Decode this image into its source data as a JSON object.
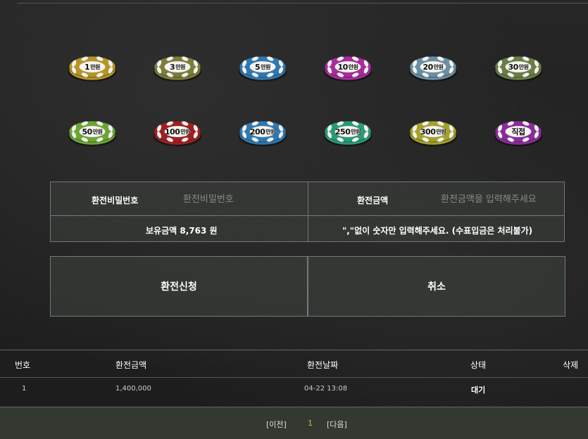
{
  "chips": [
    {
      "label": "1",
      "unit": "만원",
      "color": "#b59526"
    },
    {
      "label": "3",
      "unit": "만원",
      "color": "#7b7d3a"
    },
    {
      "label": "5",
      "unit": "만원",
      "color": "#2f78b0"
    },
    {
      "label": "10",
      "unit": "만원",
      "color": "#a82c9c"
    },
    {
      "label": "20",
      "unit": "만원",
      "color": "#6a8fa2"
    },
    {
      "label": "30",
      "unit": "만원",
      "color": "#6a7d44"
    },
    {
      "label": "50",
      "unit": "만원",
      "color": "#6aa536"
    },
    {
      "label": "100",
      "unit": "만원",
      "color": "#a01f20"
    },
    {
      "label": "200",
      "unit": "만원",
      "color": "#2f78b0"
    },
    {
      "label": "250",
      "unit": "만원",
      "color": "#2a9a76"
    },
    {
      "label": "300",
      "unit": "만원",
      "color": "#a3a12c"
    },
    {
      "label": "직접",
      "unit": "",
      "color": "#8a2d9a"
    }
  ],
  "form": {
    "password_label": "환전비밀번호",
    "password_placeholder": "환전비밀번호",
    "amount_label": "환전금액",
    "amount_placeholder": "환전금액을 입력해주세요",
    "balance_text": "보유금액 8,763 원",
    "notice_text": "\",\"없이 숫자만 입력해주세요. (수표입금은 처리불가)"
  },
  "buttons": {
    "submit": "환전신청",
    "cancel": "취소"
  },
  "history": {
    "headers": {
      "no": "번호",
      "amount": "환전금액",
      "date": "환전날짜",
      "status": "상태",
      "delete": "삭제"
    },
    "rows": [
      {
        "no": "1",
        "amount": "1,400,000",
        "date": "04-22 13:08",
        "status": "대기"
      }
    ]
  },
  "pager": {
    "prev": "[이전]",
    "current": "1",
    "next": "[다음]"
  }
}
